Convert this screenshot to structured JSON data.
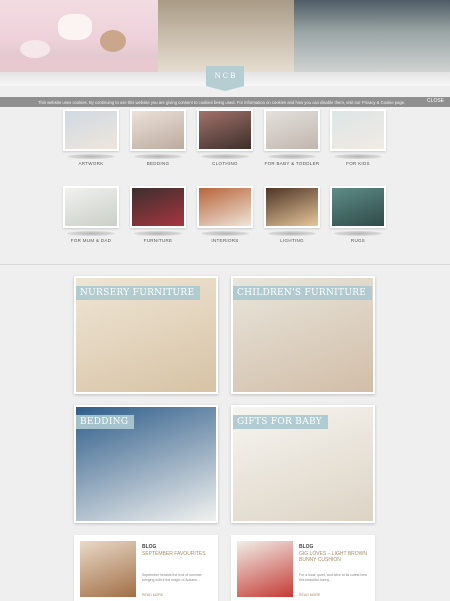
{
  "logo": {
    "letters": [
      "N",
      "C",
      "B"
    ]
  },
  "cookie_bar": {
    "text": "This website uses cookies. By continuing to use this website you are giving consent to cookies being used. For information on cookies and how you can disable them, visit our Privacy & Cookie page.",
    "close_label": "CLOSE"
  },
  "categories_row1": [
    {
      "label": "ARTWORK",
      "colors": [
        "#cfd9e2",
        "#efe6dd"
      ]
    },
    {
      "label": "BEDDING",
      "colors": [
        "#ece2d8",
        "#bcaaa0"
      ]
    },
    {
      "label": "CLOTHING",
      "colors": [
        "#a1726a",
        "#3d2f2b"
      ]
    },
    {
      "label": "FOR BABY & TODDLER",
      "colors": [
        "#e4e0dc",
        "#c1b6ae"
      ]
    },
    {
      "label": "FOR KIDS",
      "colors": [
        "#dce6e6",
        "#f2eae4"
      ]
    }
  ],
  "categories_row2": [
    {
      "label": "FOR MUM & DAD",
      "colors": [
        "#f1f1f0",
        "#c9cfc6"
      ]
    },
    {
      "label": "FURNITURE",
      "colors": [
        "#3c2f2e",
        "#a83540"
      ]
    },
    {
      "label": "INTERIORS",
      "colors": [
        "#b8653c",
        "#efe5d9"
      ]
    },
    {
      "label": "LIGHTING",
      "colors": [
        "#4e3426",
        "#e6c79b"
      ]
    },
    {
      "label": "RUGS",
      "colors": [
        "#5e8d88",
        "#2f4a48"
      ]
    }
  ],
  "features": [
    {
      "label": "NURSERY FURNITURE",
      "colors": [
        "#efe5d5",
        "#d7c3a5"
      ]
    },
    {
      "label": "CHILDREN'S FURNITURE",
      "colors": [
        "#e8e6dc",
        "#d2bda8"
      ]
    },
    {
      "label": "BEDDING",
      "colors": [
        "#2e5d8a",
        "#f1f1ef"
      ]
    },
    {
      "label": "GIFTS FOR BABY",
      "colors": [
        "#f7f5f1",
        "#dcd3c4"
      ]
    }
  ],
  "blog_posts": [
    {
      "tag": "BLOG",
      "title": "SEPTEMBER FAVOURITES",
      "excerpt": "September heralds the end of summer, bringing with it the magic of Autumn...",
      "more": "READ MORE",
      "colors": [
        "#e9d9c8",
        "#a26f46"
      ]
    },
    {
      "tag": "BLOG",
      "title": "GIG LOVES – LIGHT BROWN BUNNY CUSHION",
      "excerpt": "For a local, quiet, and alive at its cutest best this beautiful bunny...",
      "more": "READ MORE",
      "colors": [
        "#f1efe9",
        "#c53a35"
      ]
    }
  ]
}
